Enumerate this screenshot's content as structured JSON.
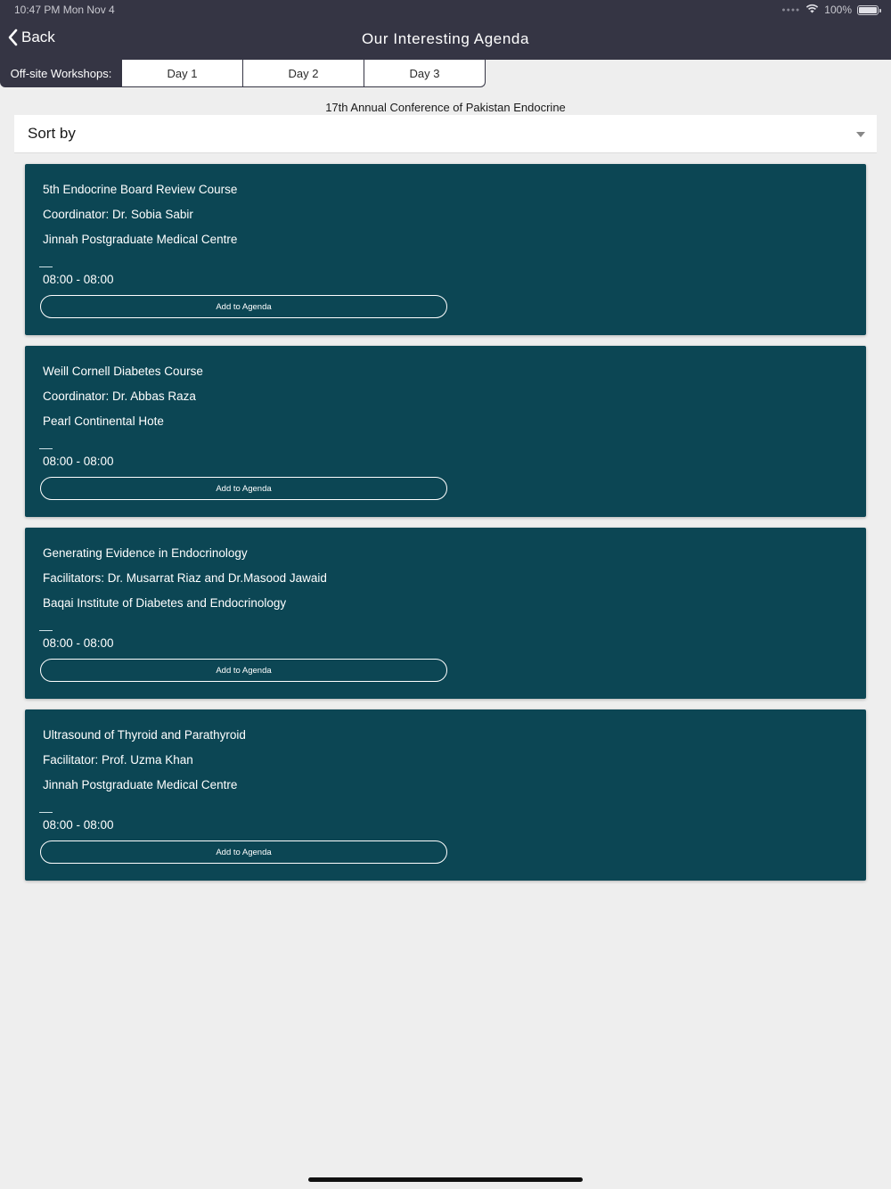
{
  "status_bar": {
    "time": "10:47 PM   Mon Nov 4",
    "battery": "100%"
  },
  "nav": {
    "back_label": "Back",
    "title": "Our Interesting Agenda"
  },
  "tabs": {
    "label": "Off-site Workshops:",
    "items": [
      "Day 1",
      "Day 2",
      "Day 3"
    ]
  },
  "conference_title": "17th Annual Conference of Pakistan Endocrine",
  "sort": {
    "label": "Sort by"
  },
  "workshops": [
    {
      "title": "5th Endocrine Board Review Course",
      "coordinator": "Coordinator: Dr. Sobia Sabir",
      "venue": "Jinnah Postgraduate Medical Centre",
      "time": "08:00 - 08:00",
      "button": "Add to Agenda"
    },
    {
      "title": "Weill Cornell Diabetes Course",
      "coordinator": "Coordinator: Dr. Abbas Raza",
      "venue": "Pearl Continental Hote",
      "time": "08:00 - 08:00",
      "button": "Add to Agenda"
    },
    {
      "title": "Generating Evidence in Endocrinology",
      "coordinator": "Facilitators: Dr. Musarrat Riaz and Dr.Masood Jawaid",
      "venue": "Baqai Institute of Diabetes and Endocrinology",
      "time": "08:00 - 08:00",
      "button": "Add to Agenda"
    },
    {
      "title": "Ultrasound of Thyroid and Parathyroid",
      "coordinator": "Facilitator: Prof. Uzma Khan",
      "venue": "Jinnah Postgraduate Medical Centre",
      "time": "08:00 - 08:00",
      "button": "Add to Agenda"
    }
  ],
  "colors": {
    "nav_bg": "#353544",
    "card_bg": "#0c4654",
    "page_bg": "#eeeeee"
  }
}
